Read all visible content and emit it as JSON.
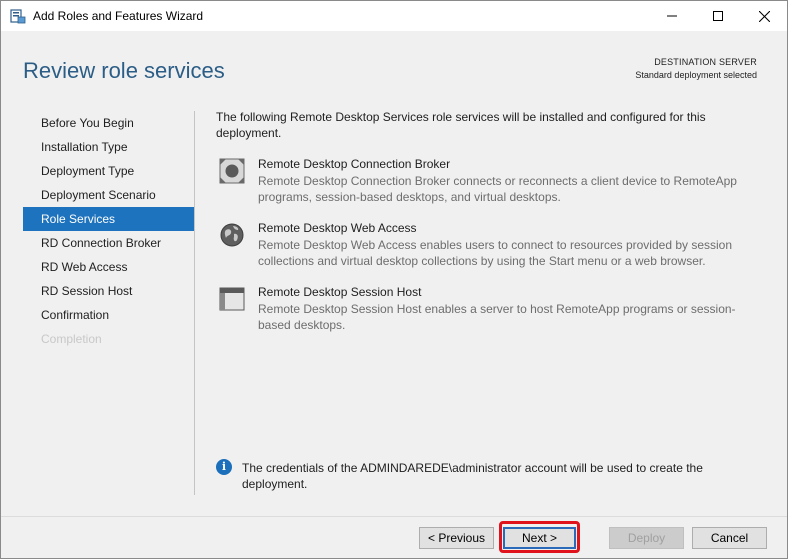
{
  "window": {
    "title": "Add Roles and Features Wizard"
  },
  "header": {
    "page_title": "Review role services",
    "destination_label": "DESTINATION SERVER",
    "destination_value": "Standard deployment selected"
  },
  "nav": {
    "items": [
      {
        "label": "Before You Begin",
        "state": "normal"
      },
      {
        "label": "Installation Type",
        "state": "normal"
      },
      {
        "label": "Deployment Type",
        "state": "normal"
      },
      {
        "label": "Deployment Scenario",
        "state": "normal"
      },
      {
        "label": "Role Services",
        "state": "active"
      },
      {
        "label": "RD Connection Broker",
        "state": "normal"
      },
      {
        "label": "RD Web Access",
        "state": "normal"
      },
      {
        "label": "RD Session Host",
        "state": "normal"
      },
      {
        "label": "Confirmation",
        "state": "normal"
      },
      {
        "label": "Completion",
        "state": "disabled"
      }
    ]
  },
  "content": {
    "intro": "The following Remote Desktop Services role services will be installed and configured for this deployment.",
    "services": [
      {
        "name": "Remote Desktop Connection Broker",
        "description": "Remote Desktop Connection Broker connects or reconnects a client device to RemoteApp programs, session-based desktops, and virtual desktops.",
        "icon": "connection-broker-icon"
      },
      {
        "name": "Remote Desktop Web Access",
        "description": "Remote Desktop Web Access enables users to connect to resources provided by session collections and virtual desktop collections by using the Start menu or a web browser.",
        "icon": "globe-icon"
      },
      {
        "name": "Remote Desktop Session Host",
        "description": "Remote Desktop Session Host enables a server to host RemoteApp programs or session-based desktops.",
        "icon": "session-host-icon"
      }
    ],
    "info": "The credentials of the ADMINDAREDE\\administrator account will be used to create the deployment."
  },
  "footer": {
    "previous": "< Previous",
    "next": "Next >",
    "deploy": "Deploy",
    "cancel": "Cancel"
  },
  "colors": {
    "accent": "#1e73be",
    "title": "#2b5d86",
    "highlight": "#e0121b"
  }
}
